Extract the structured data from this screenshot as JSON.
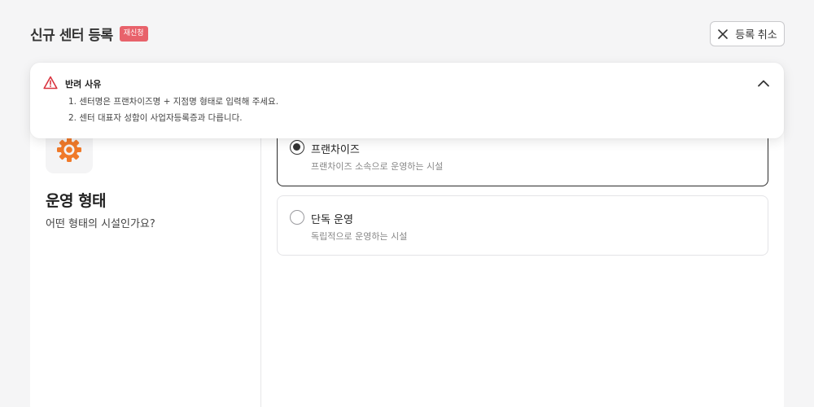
{
  "header": {
    "title": "신규 센터 등록",
    "badge": "재신청",
    "cancel_label": "등록 취소"
  },
  "rejection": {
    "title": "반려 사유",
    "reasons": [
      "1. 센터명은 프랜차이즈명 + 지점명 형태로 입력해 주세요.",
      "2. 센터 대표자 성함이 사업자등록증과 다릅니다."
    ],
    "expanded": true
  },
  "section": {
    "icon": "gear-icon",
    "title": "운영 형태",
    "subtitle": "어떤 형태의 시설인가요?"
  },
  "options": [
    {
      "label": "프랜차이즈",
      "description": "프랜차이즈 소속으로 운영하는 시설",
      "selected": true
    },
    {
      "label": "단독 운영",
      "description": "독립적으로 운영하는 시설",
      "selected": false
    }
  ],
  "colors": {
    "accent": "#f07a2a",
    "badge": "#e8626b",
    "warning": "#d9343f"
  }
}
